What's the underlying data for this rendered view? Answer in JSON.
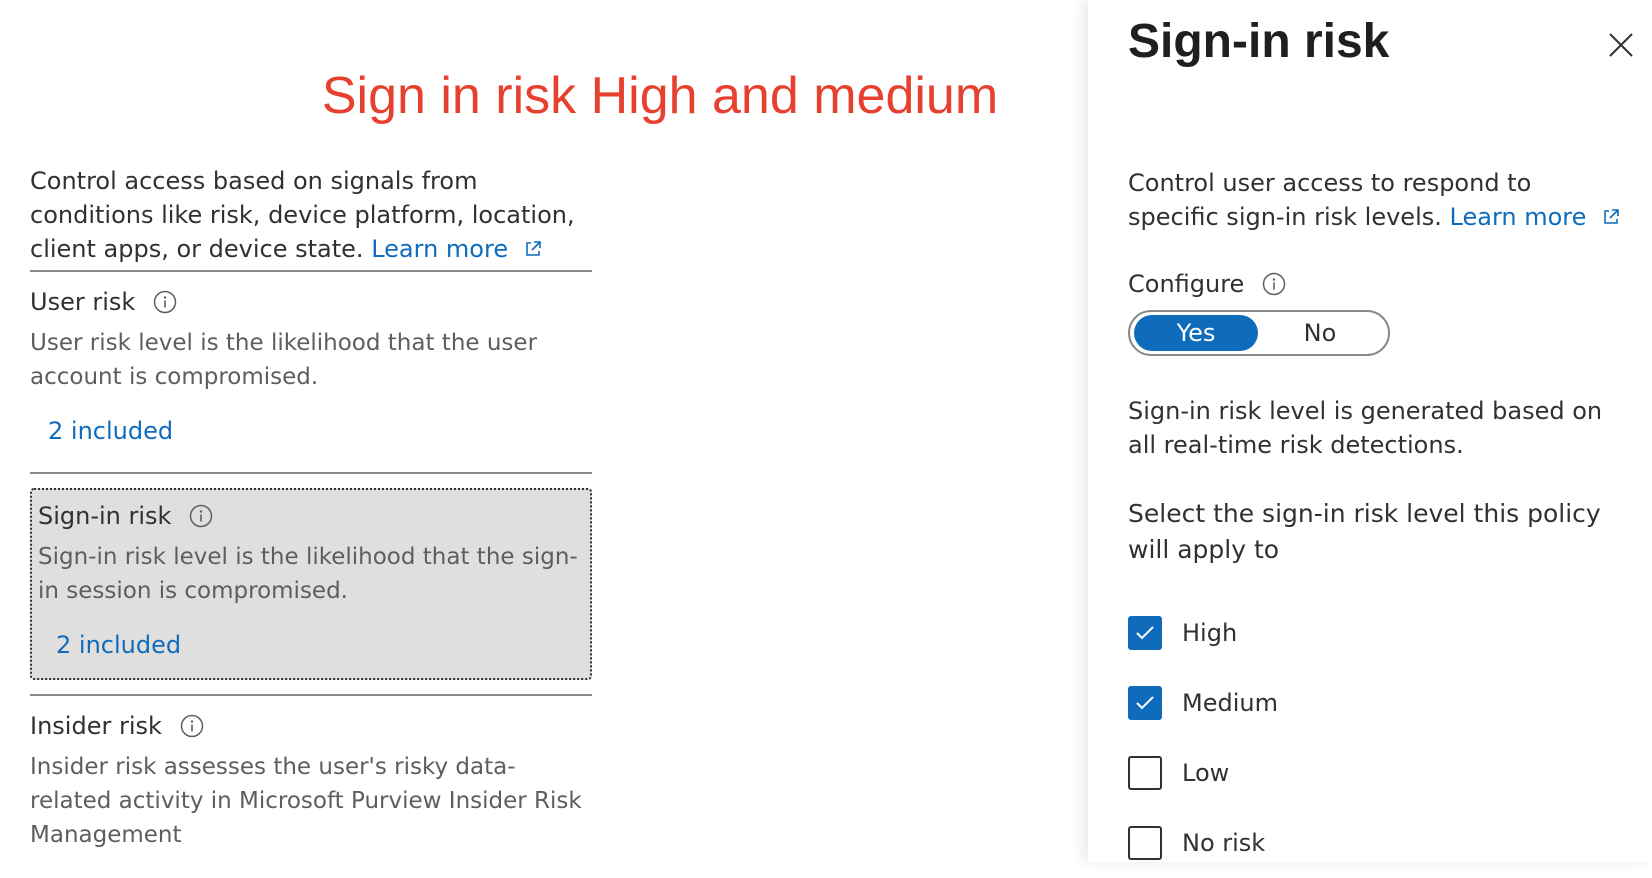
{
  "annotation": "Sign in risk High and medium",
  "left": {
    "intro_text": "Control access based on signals from conditions like risk, device platform, location, client apps, or device state.",
    "intro_link": "Learn more",
    "sections": [
      {
        "title": "User risk",
        "desc": "User risk level is the likelihood that the user account is compromised.",
        "included": "2 included"
      },
      {
        "title": "Sign-in risk",
        "desc": "Sign-in risk level is the likelihood that the sign-in session is compromised.",
        "included": "2 included"
      },
      {
        "title": "Insider risk",
        "desc": "Insider risk assesses the user's risky data-related activity in Microsoft Purview Insider Risk Management"
      }
    ]
  },
  "panel": {
    "title": "Sign-in risk",
    "intro_text": "Control user access to respond to specific sign-in risk levels.",
    "intro_link": "Learn more",
    "configure_label": "Configure",
    "toggle": {
      "yes": "Yes",
      "no": "No",
      "selected": "Yes"
    },
    "description": "Sign-in risk level is generated based on all real-time risk detections.",
    "select_label": "Select the sign-in risk level this policy will apply to",
    "levels": [
      {
        "label": "High",
        "checked": true
      },
      {
        "label": "Medium",
        "checked": true
      },
      {
        "label": "Low",
        "checked": false
      },
      {
        "label": "No risk",
        "checked": false
      }
    ]
  },
  "colors": {
    "accent": "#0f6cbd",
    "annotation": "#e8402e",
    "selected_bg": "#e1dfdd"
  }
}
